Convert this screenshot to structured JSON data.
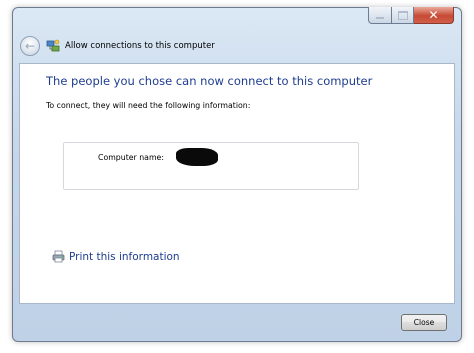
{
  "window": {
    "title": "Allow connections to this computer"
  },
  "caption_buttons": {
    "minimize_icon": "minimize-icon",
    "maximize_icon": "maximize-icon",
    "close_icon": "close-icon",
    "close_glyph": "✕"
  },
  "navigation": {
    "back_glyph": "←"
  },
  "main": {
    "heading": "The people you chose can now connect to this computer",
    "instruction": "To connect, they will need the following information:",
    "info_box": {
      "label": "Computer name:",
      "value": ""
    },
    "print_link": "Print this information"
  },
  "footer": {
    "close_label": "Close"
  },
  "colors": {
    "heading": "#1e3d8f",
    "link": "#1e3d8f",
    "frame": "#c6d7ea",
    "close_button": "#c74a35"
  }
}
